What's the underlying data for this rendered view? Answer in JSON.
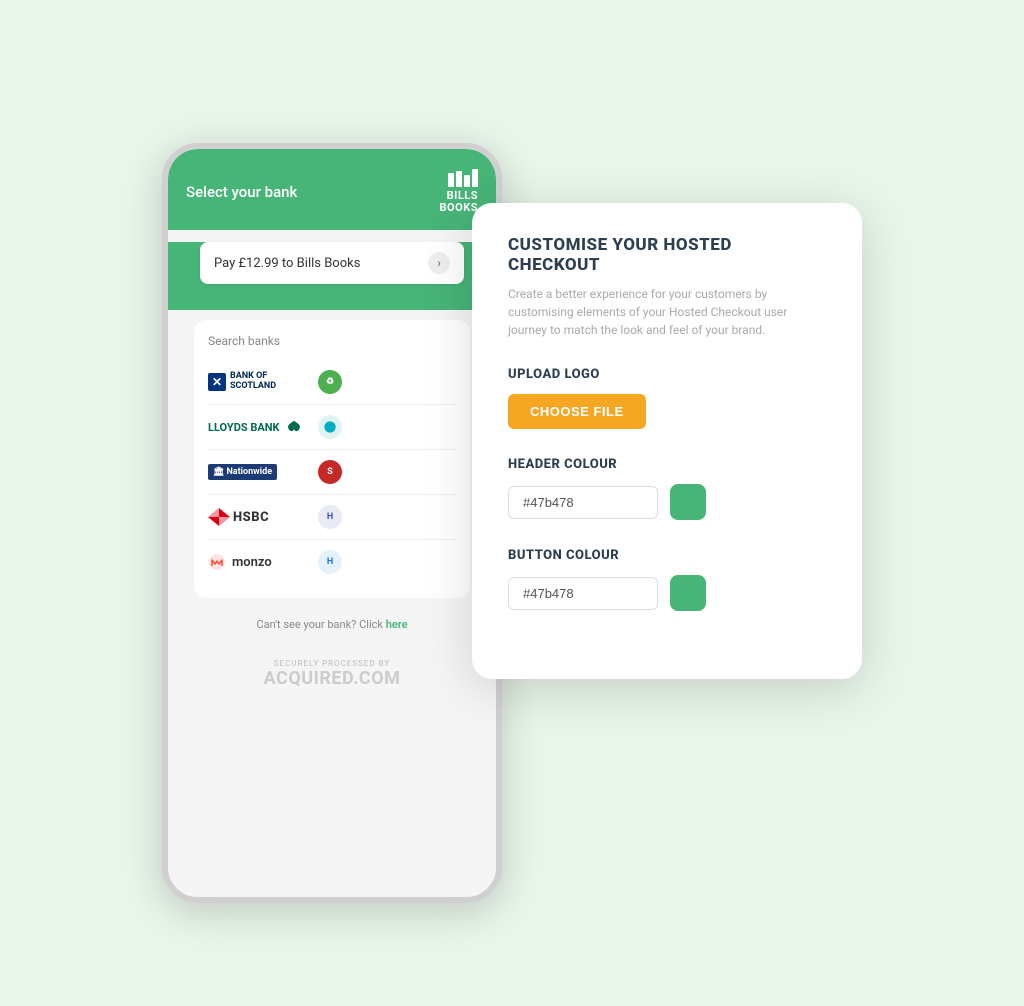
{
  "background_color": "#e8f5e9",
  "phone": {
    "header": {
      "title": "Select your bank",
      "logo_line1": "BILLS",
      "logo_line2": "BOOKS"
    },
    "pay_bar": {
      "text": "Pay £12.99 to Bills Books",
      "arrow": "›"
    },
    "search_label": "Search banks",
    "banks": [
      {
        "name": "BANK OF SCOTLAND",
        "id": "bank-of-scotland"
      },
      {
        "name": "LLOYDS BANK",
        "id": "lloyds-bank"
      },
      {
        "name": "Nationwide",
        "id": "nationwide"
      },
      {
        "name": "HSBC",
        "id": "hsbc"
      },
      {
        "name": "monzo",
        "id": "monzo"
      }
    ],
    "cant_see_bank": "Can't see your bank? Click ",
    "here_link": "here",
    "footer_small": "SECURELY PROCESSED BY",
    "footer_large": "ACQUIRED.COM"
  },
  "customise_panel": {
    "title": "CUSTOMISE YOUR HOSTED CHECKOUT",
    "description": "Create a better experience for your customers by customising elements of your Hosted Checkout user journey to match the look and feel of your brand.",
    "upload_logo": {
      "label": "UPLOAD LOGO",
      "button": "CHOOSE FILE"
    },
    "header_colour": {
      "label": "HEADER COLOUR",
      "value": "#47b478",
      "swatch_color": "#47b478"
    },
    "button_colour": {
      "label": "BUTTON COLOUR",
      "value": "#47b478",
      "swatch_color": "#47b478"
    }
  }
}
